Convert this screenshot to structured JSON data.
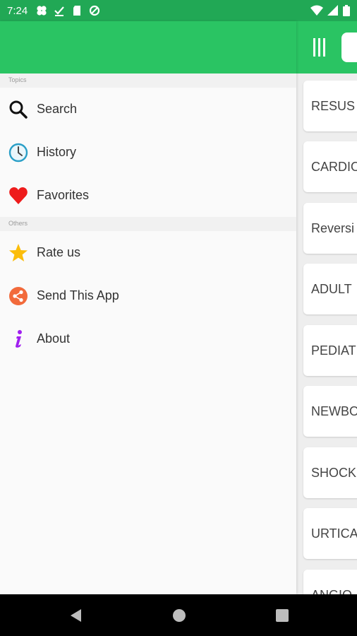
{
  "status_bar": {
    "time": "7:24"
  },
  "drawer": {
    "sections": [
      {
        "label": "Topics",
        "items": [
          {
            "label": "Search",
            "icon": "search-icon"
          },
          {
            "label": "History",
            "icon": "clock-icon"
          },
          {
            "label": "Favorites",
            "icon": "heart-icon"
          }
        ]
      },
      {
        "label": "Others",
        "items": [
          {
            "label": "Rate us",
            "icon": "star-icon"
          },
          {
            "label": "Send This App",
            "icon": "share-icon"
          },
          {
            "label": "About",
            "icon": "info-icon"
          }
        ]
      }
    ]
  },
  "main": {
    "cards": [
      "RESUS",
      "CARDIO",
      "Reversi",
      "ADULT",
      "PEDIAT",
      "NEWBO",
      "SHOCK",
      "URTICA",
      "ANGIO"
    ]
  },
  "colors": {
    "statusbar": "#21a855",
    "header": "#2ac463",
    "heart": "#ee1c1c",
    "star": "#fbbd0b",
    "share": "#f26a3b",
    "info": "#a020f0",
    "clock": "#2a9fc7"
  }
}
